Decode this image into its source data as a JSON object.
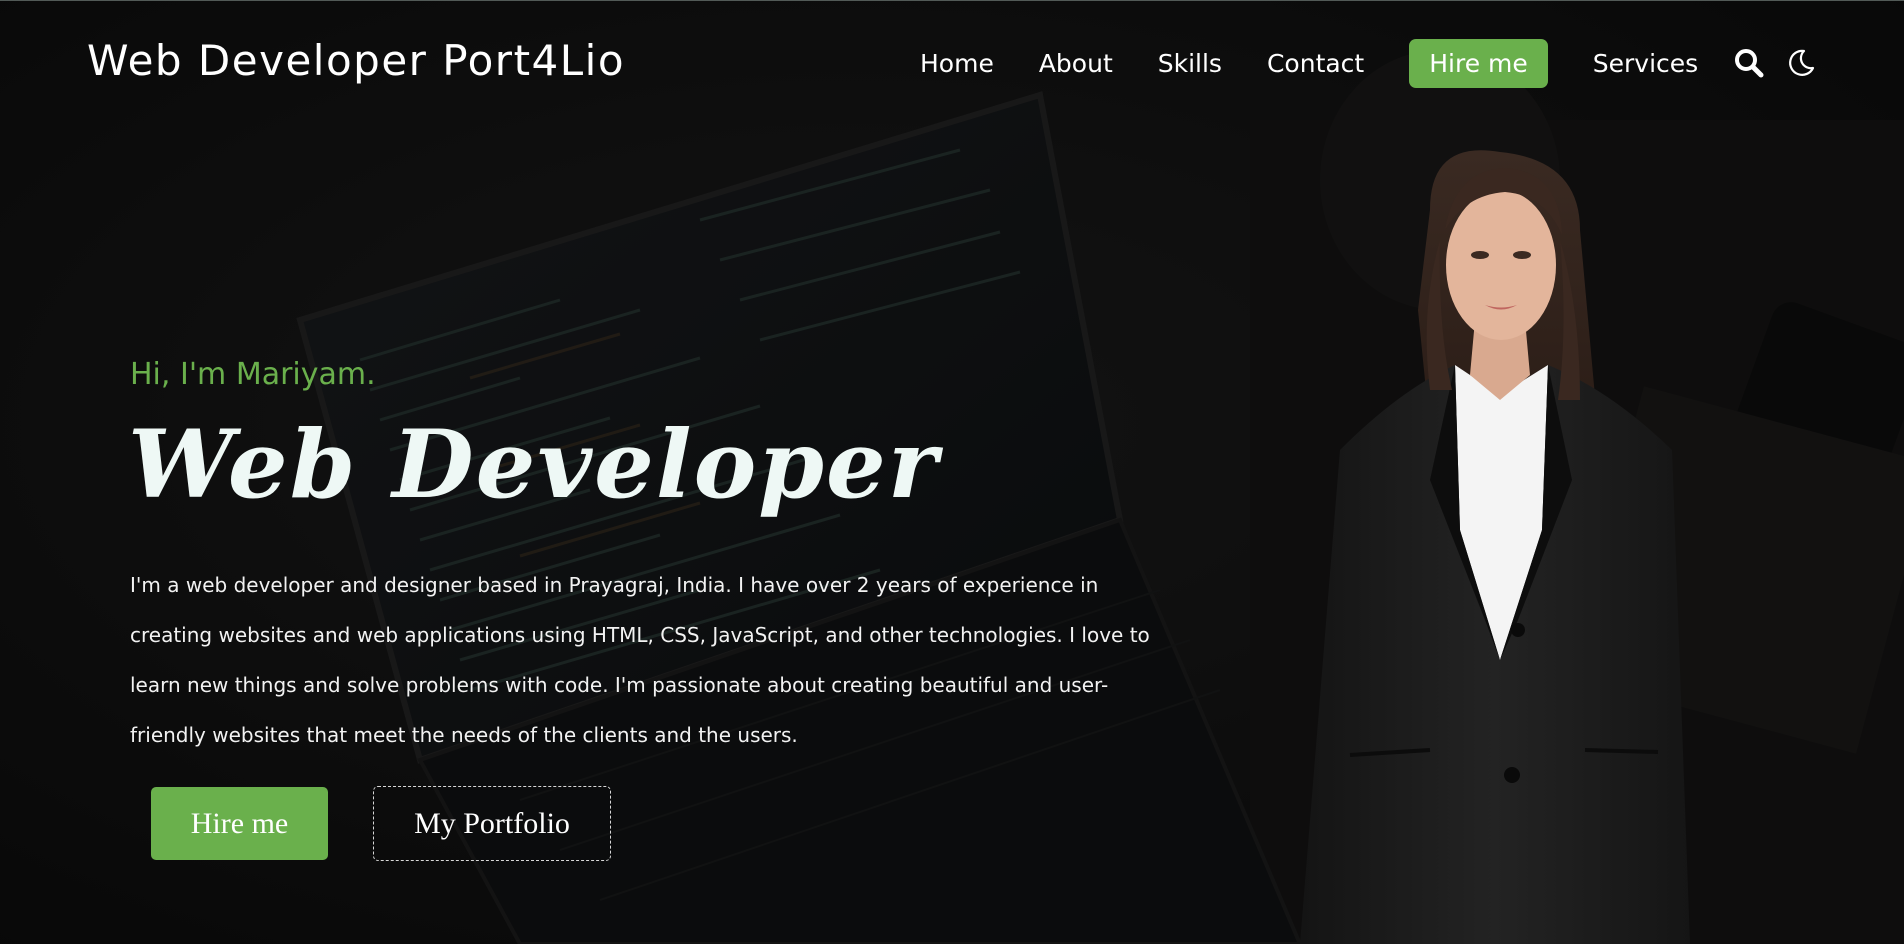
{
  "header": {
    "brand": "Web Developer Port4Lio",
    "nav": [
      {
        "label": "Home"
      },
      {
        "label": "About"
      },
      {
        "label": "Skills"
      },
      {
        "label": "Contact"
      },
      {
        "label": "Hire me"
      },
      {
        "label": "Services"
      }
    ],
    "icons": [
      "search-icon",
      "moon-icon"
    ]
  },
  "hero": {
    "greeting": "Hi, I'm Mariyam.",
    "title": "Web Developer",
    "description": "I'm a web developer and designer based in Prayagraj, India. I have over 2 years of experience in creating websites and web applications using HTML, CSS, JavaScript, and other technologies. I love to learn new things and solve problems with code. I'm passionate about creating beautiful and user-friendly websites that meet the needs of the clients and the users.",
    "primary_button": "Hire me",
    "secondary_button": "My Portfolio"
  },
  "colors": {
    "accent": "#6ab04c",
    "background": "#121212",
    "text": "#ffffff"
  }
}
